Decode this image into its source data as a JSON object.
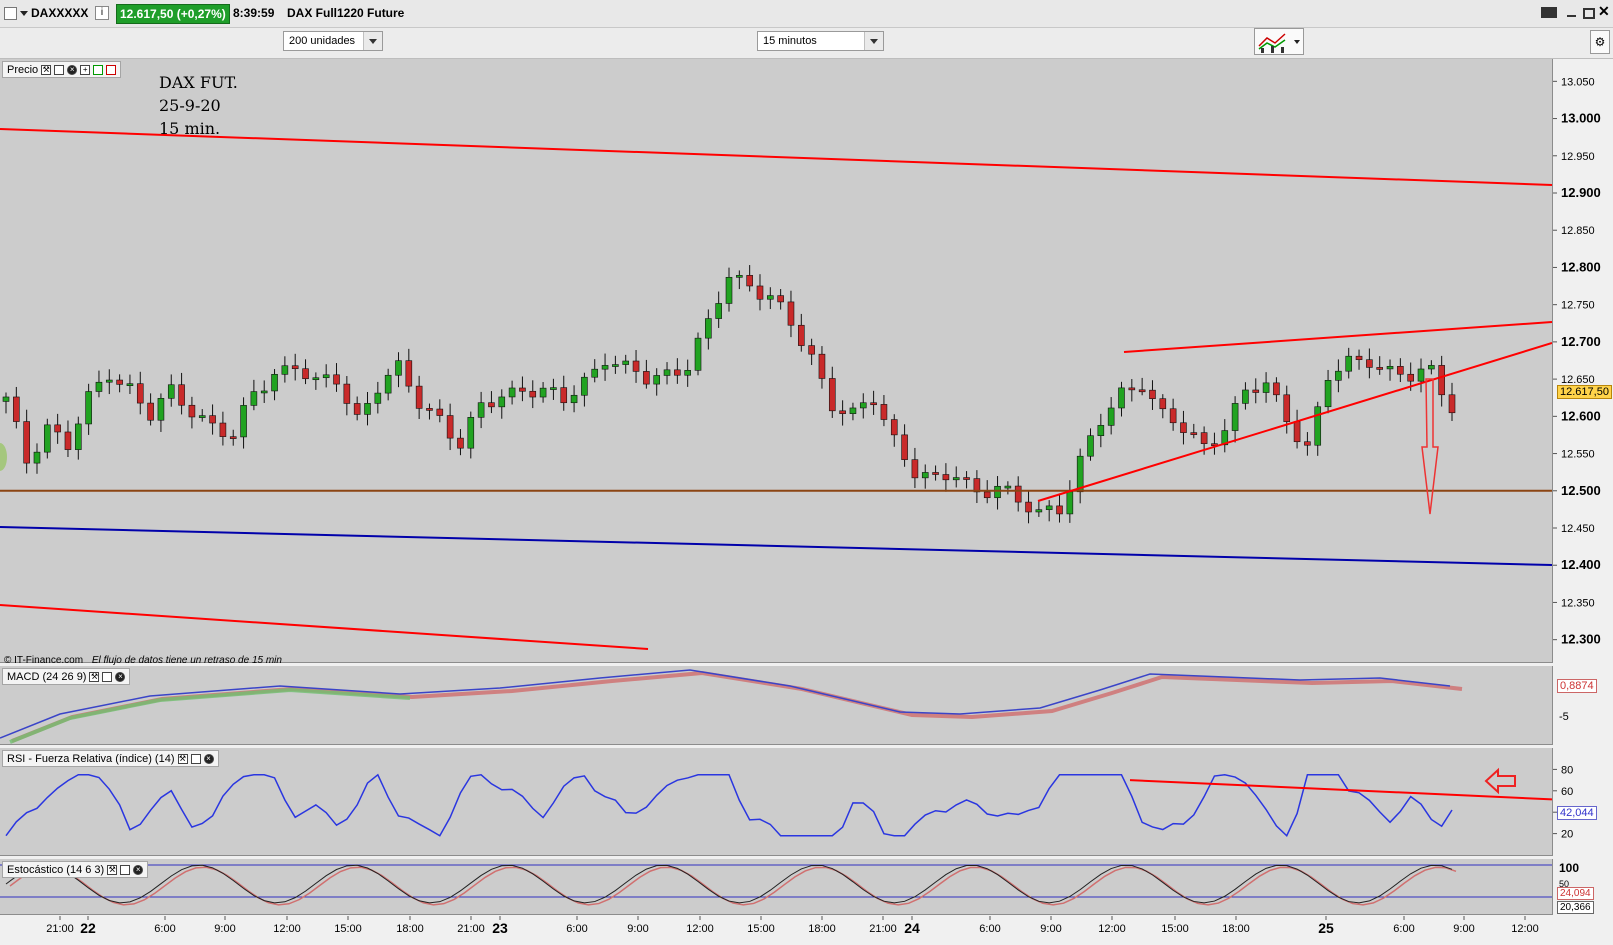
{
  "window": {
    "symbol": "DAXXXXX",
    "price_badge": "12.617,50 (+0,27%)",
    "time": "8:39:59",
    "instrument": "DAX Full1220 Future"
  },
  "toolbar": {
    "units_select": "200 unidades",
    "interval_select": "15 minutos"
  },
  "price_panel": {
    "label": "Precio",
    "annotation": [
      "DAX FUT.",
      "25-9-20",
      "15 min."
    ],
    "copyright": "© IT-Finance.com",
    "delay_notice": "El flujo de datos tiene un retraso de 15 min",
    "y_ticks": [
      "13.050",
      "13.000",
      "12.950",
      "12.900",
      "12.850",
      "12.800",
      "12.750",
      "12.700",
      "12.650",
      "12.600",
      "12.550",
      "12.500",
      "12.450",
      "12.400",
      "12.350",
      "12.300"
    ],
    "current_price": "12.617,50",
    "support_level": "12.500"
  },
  "macd_panel": {
    "label": "MACD (24 26 9)",
    "value": "0,8874",
    "tick": "-5"
  },
  "rsi_panel": {
    "label": "RSI - Fuerza Relativa (índice) (14)",
    "value": "42,044",
    "ticks": [
      "80",
      "60",
      "40",
      "20"
    ]
  },
  "stoch_panel": {
    "label": "Estocástico (14 6 3)",
    "ticks": [
      "100",
      "50"
    ],
    "value_k": "24,094",
    "value_d": "20,366"
  },
  "time_axis": [
    "21:00",
    "22",
    "6:00",
    "9:00",
    "12:00",
    "15:00",
    "18:00",
    "21:00",
    "23",
    "6:00",
    "9:00",
    "12:00",
    "15:00",
    "18:00",
    "21:00",
    "24",
    "6:00",
    "9:00",
    "12:00",
    "15:00",
    "18:00",
    "25",
    "6:00",
    "9:00",
    "12:00"
  ],
  "colors": {
    "bull": "#21a321",
    "bear": "#c92a2a",
    "trend": "#ff0000",
    "channel_blue": "#0000aa",
    "support": "#8b4513",
    "rsi_line": "#2a36e0",
    "badge_bg": "#1f9e2a"
  },
  "chart_data": [
    {
      "type": "candlestick",
      "title": "DAX FUT. 25-9-20 15 min.",
      "ylim": [
        12270,
        13080
      ],
      "close_path": [
        [
          0,
          12620
        ],
        [
          2,
          12540
        ],
        [
          4,
          12590
        ],
        [
          6,
          12560
        ],
        [
          8,
          12620
        ],
        [
          10,
          12660
        ],
        [
          12,
          12640
        ],
        [
          14,
          12600
        ],
        [
          16,
          12630
        ],
        [
          18,
          12610
        ],
        [
          20,
          12590
        ],
        [
          22,
          12570
        ],
        [
          24,
          12630
        ],
        [
          26,
          12660
        ],
        [
          28,
          12670
        ],
        [
          30,
          12640
        ],
        [
          32,
          12650
        ],
        [
          34,
          12600
        ],
        [
          36,
          12640
        ],
        [
          38,
          12660
        ],
        [
          40,
          12620
        ],
        [
          42,
          12600
        ],
        [
          44,
          12560
        ],
        [
          46,
          12610
        ],
        [
          48,
          12630
        ],
        [
          50,
          12640
        ],
        [
          52,
          12630
        ],
        [
          54,
          12620
        ],
        [
          56,
          12650
        ],
        [
          58,
          12680
        ],
        [
          60,
          12660
        ],
        [
          62,
          12650
        ],
        [
          64,
          12660
        ],
        [
          66,
          12670
        ],
        [
          68,
          12720
        ],
        [
          70,
          12790
        ],
        [
          72,
          12780
        ],
        [
          74,
          12760
        ],
        [
          76,
          12720
        ],
        [
          78,
          12680
        ],
        [
          80,
          12620
        ],
        [
          82,
          12600
        ],
        [
          84,
          12620
        ],
        [
          86,
          12570
        ],
        [
          88,
          12530
        ],
        [
          90,
          12510
        ],
        [
          92,
          12520
        ],
        [
          94,
          12500
        ],
        [
          96,
          12510
        ],
        [
          98,
          12480
        ],
        [
          100,
          12470
        ],
        [
          102,
          12480
        ],
        [
          104,
          12540
        ],
        [
          106,
          12590
        ],
        [
          108,
          12630
        ],
        [
          110,
          12650
        ],
        [
          112,
          12600
        ],
        [
          114,
          12580
        ],
        [
          116,
          12560
        ],
        [
          118,
          12590
        ],
        [
          120,
          12630
        ],
        [
          122,
          12640
        ],
        [
          124,
          12600
        ],
        [
          126,
          12560
        ],
        [
          128,
          12650
        ],
        [
          130,
          12670
        ],
        [
          132,
          12680
        ],
        [
          134,
          12660
        ],
        [
          136,
          12650
        ],
        [
          138,
          12660
        ],
        [
          140,
          12617
        ]
      ]
    },
    {
      "type": "line",
      "title": "RSI - Fuerza Relativa (índice) (14)",
      "ylim": [
        0,
        100
      ],
      "ticks": [
        20,
        40,
        60,
        80
      ],
      "last": 42.044
    }
  ]
}
